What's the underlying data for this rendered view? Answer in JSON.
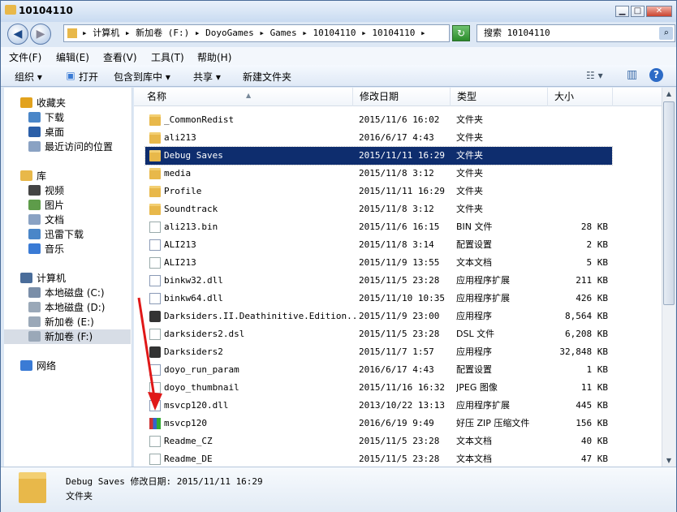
{
  "window": {
    "title": "10104110"
  },
  "controls": {
    "minimize": "▁",
    "maximize": "□",
    "close": "✕"
  },
  "nav": {
    "back_icon": "◀",
    "forward_icon": "▶",
    "address": "▸ 计算机 ▸ 新加卷 (F:) ▸ DoyoGames ▸ Games ▸ 10104110 ▸ 10104110 ▸",
    "refresh_icon": "↻",
    "search_placeholder": "搜索 10104110"
  },
  "menu": [
    "文件(F)",
    "编辑(E)",
    "查看(V)",
    "工具(T)",
    "帮助(H)"
  ],
  "toolbar": {
    "organize": "组织 ▾",
    "open": "打开",
    "include": "包含到库中 ▾",
    "share": "共享 ▾",
    "new_folder": "新建文件夹",
    "view_icon": "☷ ▾",
    "pane_icon": "▥",
    "help_icon": "?"
  },
  "navpane": [
    {
      "label": "收藏夹",
      "icon": "star-icon",
      "color": "#e2a21d"
    },
    {
      "label": "下载",
      "icon": "download-folder-icon",
      "color": "#4a86c8"
    },
    {
      "label": "桌面",
      "icon": "desktop-icon",
      "color": "#2b5fa8"
    },
    {
      "label": "最近访问的位置",
      "icon": "recent-places-icon",
      "color": "#8aa2c3"
    },
    {
      "label": "库",
      "icon": "library-icon",
      "color": "#e8b84a"
    },
    {
      "label": "视频",
      "icon": "video-icon",
      "color": "#444"
    },
    {
      "label": "图片",
      "icon": "pictures-icon",
      "color": "#5e9c4a"
    },
    {
      "label": "文档",
      "icon": "documents-icon",
      "color": "#8aa2c3"
    },
    {
      "label": "迅雷下载",
      "icon": "thunder-download-icon",
      "color": "#4a86c8"
    },
    {
      "label": "音乐",
      "icon": "music-icon",
      "color": "#3a7bd5"
    },
    {
      "label": "计算机",
      "icon": "computer-icon",
      "color": "#4a6d9a"
    },
    {
      "label": "本地磁盘 (C:)",
      "icon": "windows-drive-icon",
      "color": "#7a8ea8"
    },
    {
      "label": "本地磁盘 (D:)",
      "icon": "drive-icon",
      "color": "#9aa8b8"
    },
    {
      "label": "新加卷 (E:)",
      "icon": "drive-icon",
      "color": "#9aa8b8"
    },
    {
      "label": "新加卷 (F:)",
      "icon": "drive-icon",
      "color": "#9aa8b8"
    },
    {
      "label": "网络",
      "icon": "network-icon",
      "color": "#3a7bd5"
    }
  ],
  "columns": {
    "name": "名称",
    "date": "修改日期",
    "type": "类型",
    "size": "大小",
    "sort_icon": "▲"
  },
  "files": [
    {
      "name": "_CommonRedist",
      "date": "2015/11/6 16:02",
      "type": "文件夹",
      "size": "",
      "icon": "fold"
    },
    {
      "name": "ali213",
      "date": "2016/6/17 4:43",
      "type": "文件夹",
      "size": "",
      "icon": "fold"
    },
    {
      "name": "Debug Saves",
      "date": "2015/11/11 16:29",
      "type": "文件夹",
      "size": "",
      "icon": "fold"
    },
    {
      "name": "media",
      "date": "2015/11/8 3:12",
      "type": "文件夹",
      "size": "",
      "icon": "fold"
    },
    {
      "name": "Profile",
      "date": "2015/11/11 16:29",
      "type": "文件夹",
      "size": "",
      "icon": "fold"
    },
    {
      "name": "Soundtrack",
      "date": "2015/11/8 3:12",
      "type": "文件夹",
      "size": "",
      "icon": "fold"
    },
    {
      "name": "ali213.bin",
      "date": "2015/11/6 16:15",
      "type": "BIN 文件",
      "size": "28 KB",
      "icon": "doc"
    },
    {
      "name": "ALI213",
      "date": "2015/11/8 3:14",
      "type": "配置设置",
      "size": "2 KB",
      "icon": "dll"
    },
    {
      "name": "ALI213",
      "date": "2015/11/9 13:55",
      "type": "文本文档",
      "size": "5 KB",
      "icon": "doc"
    },
    {
      "name": "binkw32.dll",
      "date": "2015/11/5 23:28",
      "type": "应用程序扩展",
      "size": "211 KB",
      "icon": "dll"
    },
    {
      "name": "binkw64.dll",
      "date": "2015/11/10 10:35",
      "type": "应用程序扩展",
      "size": "426 KB",
      "icon": "dll"
    },
    {
      "name": "Darksiders.II.Deathinitive.Edition...",
      "date": "2015/11/9 23:00",
      "type": "应用程序",
      "size": "8,564 KB",
      "icon": "exe"
    },
    {
      "name": "darksiders2.dsl",
      "date": "2015/11/5 23:28",
      "type": "DSL 文件",
      "size": "6,208 KB",
      "icon": "doc"
    },
    {
      "name": "Darksiders2",
      "date": "2015/11/7 1:57",
      "type": "应用程序",
      "size": "32,848 KB",
      "icon": "exe"
    },
    {
      "name": "doyo_run_param",
      "date": "2016/6/17 4:43",
      "type": "配置设置",
      "size": "1 KB",
      "icon": "dll"
    },
    {
      "name": "doyo_thumbnail",
      "date": "2015/11/16 16:32",
      "type": "JPEG 图像",
      "size": "11 KB",
      "icon": "doc"
    },
    {
      "name": "msvcp120.dll",
      "date": "2013/10/22 13:13",
      "type": "应用程序扩展",
      "size": "445 KB",
      "icon": "dll"
    },
    {
      "name": "msvcp120",
      "date": "2016/6/19 9:49",
      "type": "好压 ZIP 压缩文件",
      "size": "156 KB",
      "icon": "zip"
    },
    {
      "name": "Readme_CZ",
      "date": "2015/11/5 23:28",
      "type": "文本文档",
      "size": "40 KB",
      "icon": "doc"
    },
    {
      "name": "Readme_DE",
      "date": "2015/11/5 23:28",
      "type": "文本文档",
      "size": "47 KB",
      "icon": "doc"
    }
  ],
  "selected_index": 2,
  "details": {
    "name_line": "Debug Saves  修改日期: 2015/11/11 16:29",
    "type": "文件夹"
  },
  "colors": {
    "selection": "#0e2d6e",
    "accent": "#4a6d9a"
  }
}
